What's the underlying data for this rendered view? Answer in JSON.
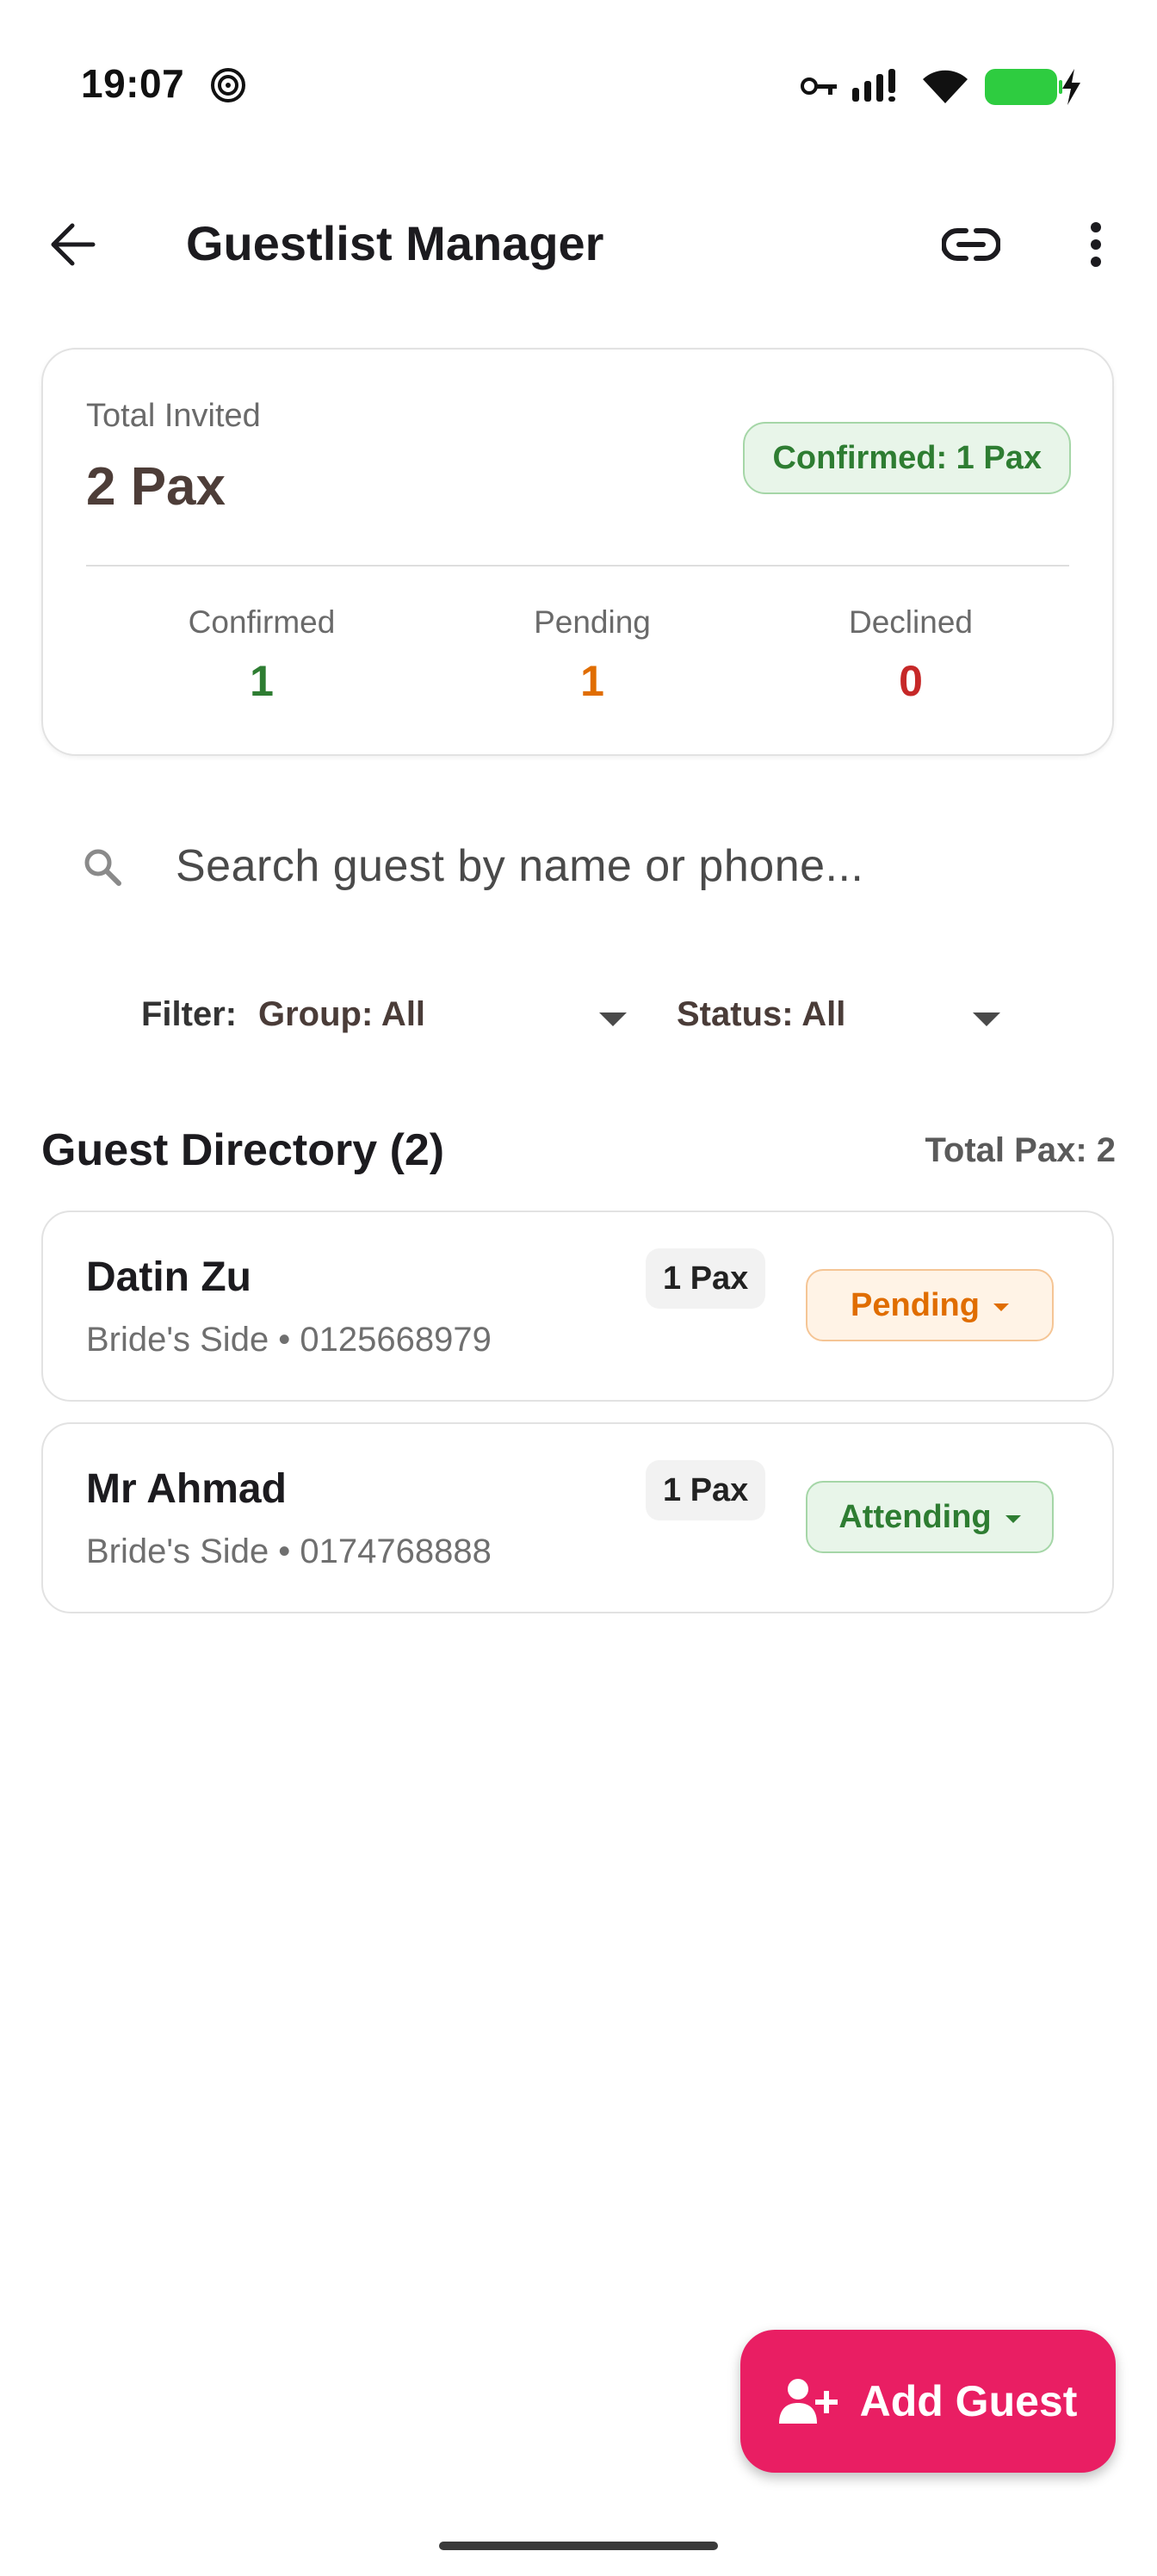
{
  "status_bar": {
    "time": "19:07"
  },
  "app_bar": {
    "title": "Guestlist Manager"
  },
  "summary": {
    "total_label": "Total Invited",
    "total_value": "2 Pax",
    "confirmed_badge": "Confirmed: 1 Pax",
    "stats": [
      {
        "label": "Confirmed",
        "value": "1",
        "color": "#2e7d32"
      },
      {
        "label": "Pending",
        "value": "1",
        "color": "#e06d00"
      },
      {
        "label": "Declined",
        "value": "0",
        "color": "#c62828"
      }
    ]
  },
  "search": {
    "placeholder": "Search guest by name or phone..."
  },
  "filters": {
    "label": "Filter:",
    "group": "Group: All",
    "status": "Status: All"
  },
  "directory": {
    "title": "Guest Directory (2)",
    "total": "Total Pax: 2",
    "guests": [
      {
        "name": "Datin Zu",
        "subtitle": "Bride's Side • 0125668979",
        "pax": "1 Pax",
        "status": "Pending"
      },
      {
        "name": "Mr Ahmad",
        "subtitle": "Bride's Side • 0174768888",
        "pax": "1 Pax",
        "status": "Attending"
      }
    ]
  },
  "fab": {
    "label": "Add Guest"
  },
  "colors": {
    "accent": "#e91e63",
    "confirmed": "#2e7d32",
    "pending": "#e06d00",
    "declined": "#c62828"
  }
}
